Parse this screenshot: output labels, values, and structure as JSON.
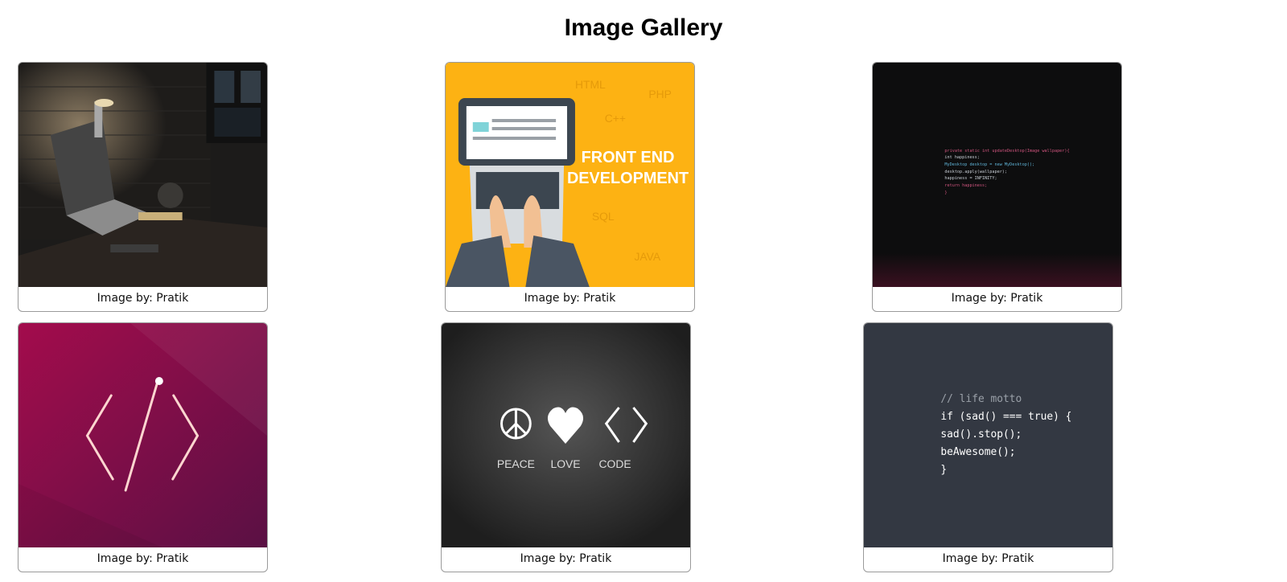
{
  "page": {
    "title": "Image Gallery"
  },
  "gallery": {
    "items": [
      {
        "alt": "desk with laptop and lamp",
        "caption": "Image by: Pratik"
      },
      {
        "alt": "front end development illustration",
        "caption": "Image by: Pratik",
        "art_text": {
          "headline_1": "FRONT END",
          "headline_2": "DEVELOPMENT",
          "langs": [
            "HTML",
            "PHP",
            "C++",
            "SQL",
            "JAVA"
          ]
        }
      },
      {
        "alt": "dark code wallpaper",
        "caption": "Image by: Pratik",
        "art_text": {
          "code_lines": [
            "private static int updateDesktop(Image wallpaper){",
            "    int happiness;",
            "    MyDesktop desktop = new MyDesktop();",
            "    desktop.apply(wallpaper);",
            "    happiness = INFINITY;",
            "    return happiness;",
            "}"
          ]
        }
      },
      {
        "alt": "neon code symbol on magenta",
        "caption": "Image by: Pratik"
      },
      {
        "alt": "peace love code",
        "caption": "Image by: Pratik",
        "art_text": {
          "labels": [
            "PEACE",
            "LOVE",
            "CODE"
          ]
        }
      },
      {
        "alt": "life motto code",
        "caption": "Image by: Pratik",
        "art_text": {
          "code_lines": [
            "// life motto",
            "if (sad() === true) {",
            " sad().stop();",
            " beAwesome();",
            "}"
          ]
        }
      }
    ]
  }
}
